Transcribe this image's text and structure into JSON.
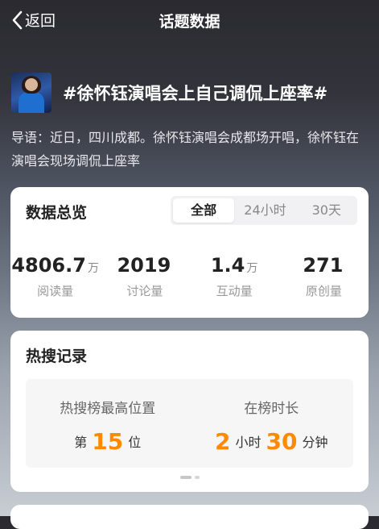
{
  "nav": {
    "back_label": "返回",
    "title": "话题数据"
  },
  "topic": {
    "title": "#徐怀钰演唱会上自己调侃上座率#",
    "lead": "导语：近日，四川成都。徐怀钰演唱会成都场开唱，徐怀钰在演唱会现场调侃上座率"
  },
  "overview": {
    "title": "数据总览",
    "tabs": [
      {
        "label": "全部",
        "active": true
      },
      {
        "label": "24小时",
        "active": false
      },
      {
        "label": "30天",
        "active": false
      }
    ],
    "stats": [
      {
        "value": "4806.7",
        "unit": "万",
        "label": "阅读量"
      },
      {
        "value": "2019",
        "unit": "",
        "label": "讨论量"
      },
      {
        "value": "1.4",
        "unit": "万",
        "label": "互动量"
      },
      {
        "value": "271",
        "unit": "",
        "label": "原创量"
      }
    ]
  },
  "hot": {
    "title": "热搜记录",
    "peak": {
      "label": "热搜榜最高位置",
      "prefix": "第",
      "value": "15",
      "suffix": "位"
    },
    "duration": {
      "label": "在榜时长",
      "hours": "2",
      "hours_unit": "小时",
      "minutes": "30",
      "minutes_unit": "分钟"
    },
    "pager": {
      "pages": 2,
      "current": 1
    }
  },
  "colors": {
    "accent": "#ff8a00",
    "card": "#ffffff"
  },
  "icons": {
    "back": "chevron-left-icon",
    "avatar": "topic-avatar-image"
  }
}
